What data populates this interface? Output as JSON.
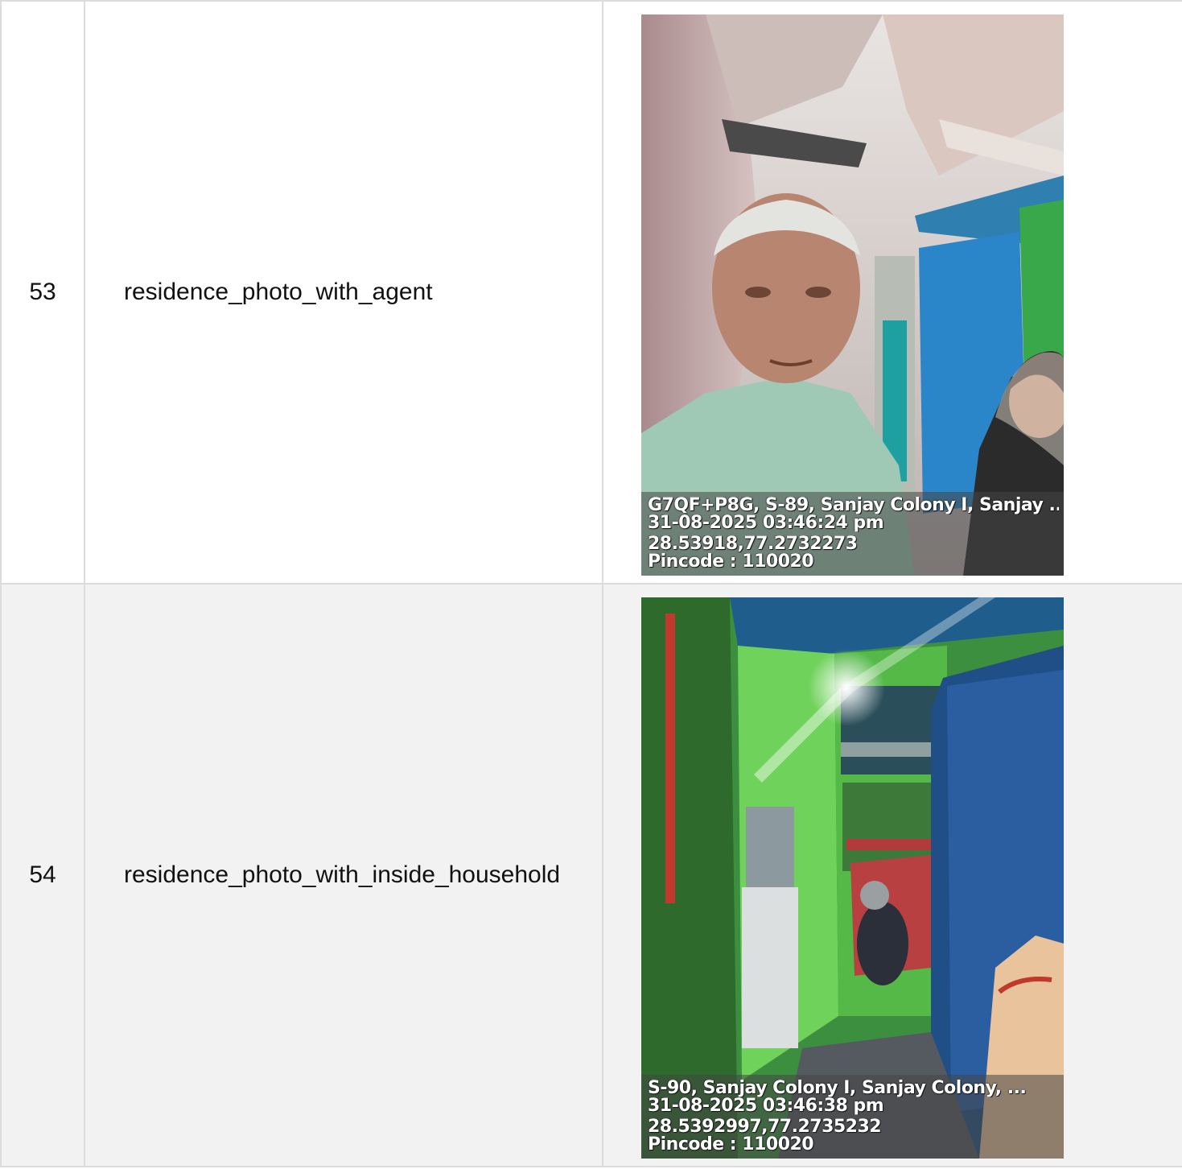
{
  "rows": [
    {
      "number": "53",
      "label": "residence_photo_with_agent",
      "photo": {
        "address": "G7QF+P8G, S-89, Sanjay Colony I, Sanjay ..",
        "datetime": "31-08-2025 03:46:24 pm",
        "coordinates": "28.53918,77.2732273",
        "pincode": "Pincode : 110020"
      }
    },
    {
      "number": "54",
      "label": "residence_photo_with_inside_household",
      "photo": {
        "address": "S-90, Sanjay Colony I, Sanjay Colony, ...",
        "datetime": "31-08-2025 03:46:38 pm",
        "coordinates": "28.5392997,77.2735232",
        "pincode": "Pincode : 110020"
      }
    }
  ]
}
